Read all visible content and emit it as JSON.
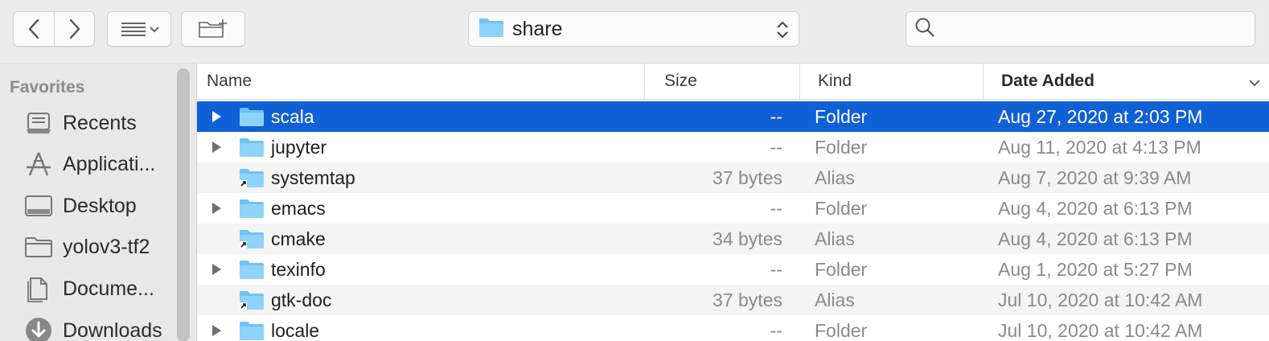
{
  "toolbar": {
    "back_icon": "chevron-left-icon",
    "forward_icon": "chevron-right-icon",
    "view_icon": "list-view-icon",
    "new_folder_icon": "new-folder-icon",
    "path_label": "share",
    "search_placeholder": ""
  },
  "sidebar": {
    "heading": "Favorites",
    "items": [
      {
        "label": "Recents",
        "icon": "recents-icon"
      },
      {
        "label": "Applicati...",
        "icon": "applications-icon"
      },
      {
        "label": "Desktop",
        "icon": "desktop-icon"
      },
      {
        "label": "yolov3-tf2",
        "icon": "folder-icon"
      },
      {
        "label": "Docume...",
        "icon": "documents-icon"
      },
      {
        "label": "Downloads",
        "icon": "downloads-icon"
      }
    ]
  },
  "columns": {
    "name": "Name",
    "size": "Size",
    "kind": "Kind",
    "date": "Date Added"
  },
  "files": [
    {
      "name": "scala",
      "size": "--",
      "kind": "Folder",
      "date": "Aug 27, 2020 at 2:03 PM",
      "expandable": true,
      "alias": false,
      "selected": true
    },
    {
      "name": "jupyter",
      "size": "--",
      "kind": "Folder",
      "date": "Aug 11, 2020 at 4:13 PM",
      "expandable": true,
      "alias": false,
      "selected": false
    },
    {
      "name": "systemtap",
      "size": "37 bytes",
      "kind": "Alias",
      "date": "Aug 7, 2020 at 9:39 AM",
      "expandable": false,
      "alias": true,
      "selected": false
    },
    {
      "name": "emacs",
      "size": "--",
      "kind": "Folder",
      "date": "Aug 4, 2020 at 6:13 PM",
      "expandable": true,
      "alias": false,
      "selected": false
    },
    {
      "name": "cmake",
      "size": "34 bytes",
      "kind": "Alias",
      "date": "Aug 4, 2020 at 6:13 PM",
      "expandable": false,
      "alias": true,
      "selected": false
    },
    {
      "name": "texinfo",
      "size": "--",
      "kind": "Folder",
      "date": "Aug 1, 2020 at 5:27 PM",
      "expandable": true,
      "alias": false,
      "selected": false
    },
    {
      "name": "gtk-doc",
      "size": "37 bytes",
      "kind": "Alias",
      "date": "Jul 10, 2020 at 10:42 AM",
      "expandable": false,
      "alias": true,
      "selected": false
    },
    {
      "name": "locale",
      "size": "--",
      "kind": "Folder",
      "date": "Jul 10, 2020 at 10:42 AM",
      "expandable": true,
      "alias": false,
      "selected": false
    }
  ],
  "colors": {
    "selection": "#1060d6",
    "folder": "#6cc3f5"
  }
}
